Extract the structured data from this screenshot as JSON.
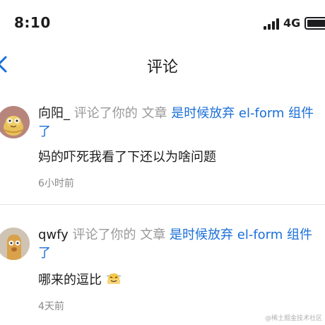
{
  "status_bar": {
    "time": "8:10",
    "network": "4G"
  },
  "nav": {
    "title": "评论"
  },
  "comments": [
    {
      "user": "向阳_",
      "action": "评论了你的 文章",
      "article": "是时候放弃 el-form 组件了",
      "content": "妈的吓死我看了下还以为啥问题",
      "time": "6小时前"
    },
    {
      "user": "qwfy",
      "action": "评论了你的 文章",
      "article": "是时候放弃 el-form 组件了",
      "content": "哪来的逗比",
      "time": "4天前"
    }
  ],
  "watermark": "@稀土掘金技术社区",
  "colors": {
    "link": "#1a6fd8",
    "secondary": "#999999",
    "divider": "#e5e5e5"
  }
}
